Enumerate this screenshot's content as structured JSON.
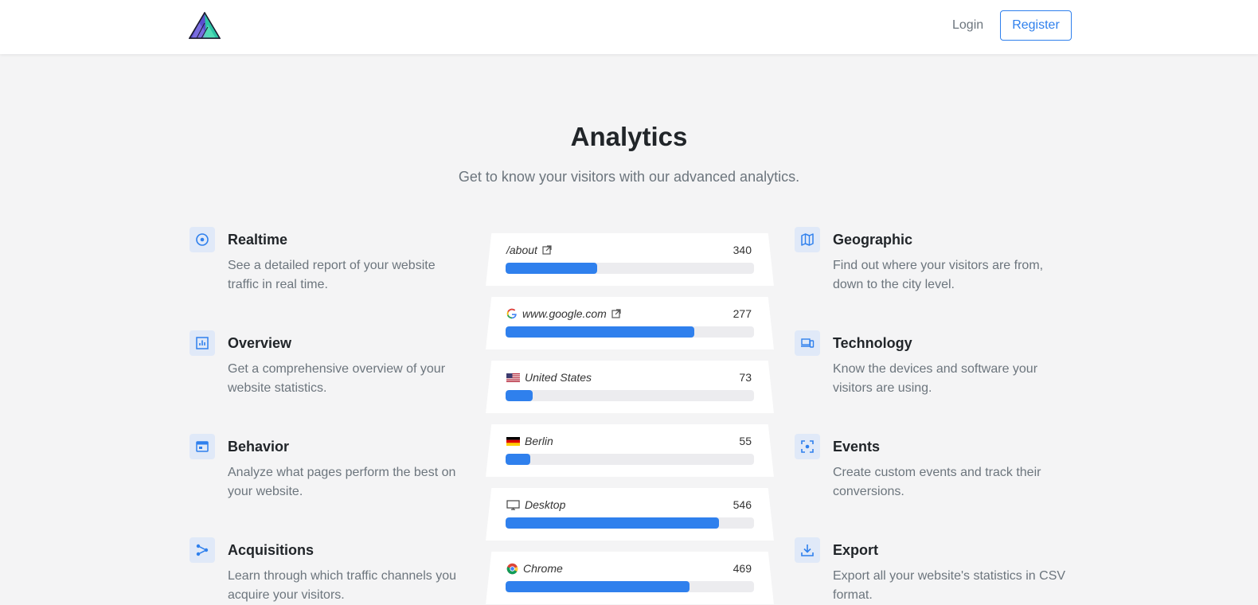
{
  "nav": {
    "login": "Login",
    "register": "Register"
  },
  "hero": {
    "title": "Analytics",
    "subtitle": "Get to know your visitors with our advanced analytics."
  },
  "accent": "#2f80ed",
  "features_left": [
    {
      "icon": "realtime-icon",
      "title": "Realtime",
      "desc": "See a detailed report of your website traffic in real time."
    },
    {
      "icon": "overview-chart-icon",
      "title": "Overview",
      "desc": "Get a comprehensive overview of your website statistics."
    },
    {
      "icon": "behavior-window-icon",
      "title": "Behavior",
      "desc": "Analyze what pages perform the best on your website."
    },
    {
      "icon": "acquisitions-share-icon",
      "title": "Acquisitions",
      "desc": "Learn through which traffic channels you acquire your visitors."
    }
  ],
  "features_right": [
    {
      "icon": "map-icon",
      "title": "Geographic",
      "desc": "Find out where your visitors are from, down to the city level."
    },
    {
      "icon": "devices-icon",
      "title": "Technology",
      "desc": "Know the devices and software your visitors are using."
    },
    {
      "icon": "events-focus-icon",
      "title": "Events",
      "desc": "Create custom events and track their conversions."
    },
    {
      "icon": "download-icon",
      "title": "Export",
      "desc": "Export all your website's statistics in CSV format."
    }
  ],
  "stat_cards": [
    {
      "icon": "",
      "label": "/about",
      "value": "340",
      "progress": 0.37
    },
    {
      "icon": "google-icon",
      "label": "www.google.com",
      "value": "277",
      "progress": 0.76
    },
    {
      "icon": "us-flag-icon",
      "label": "United States",
      "value": "73",
      "progress": 0.11
    },
    {
      "icon": "de-flag-icon",
      "label": "Berlin",
      "value": "55",
      "progress": 0.1
    },
    {
      "icon": "desktop-icon",
      "label": "Desktop",
      "value": "546",
      "progress": 0.86
    },
    {
      "icon": "chrome-icon",
      "label": "Chrome",
      "value": "469",
      "progress": 0.74
    }
  ]
}
